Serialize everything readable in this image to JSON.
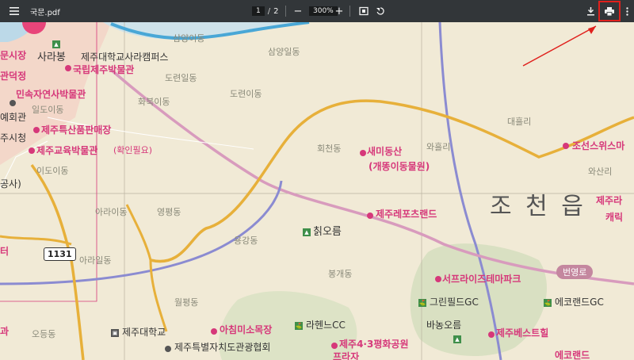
{
  "toolbar": {
    "menu_icon": "hamburger-menu-icon",
    "filename": "국문.pdf",
    "current_page": "1",
    "page_sep": "/",
    "total_pages": "2",
    "zoom_out": "−",
    "zoom_level": "300%",
    "zoom_in": "+",
    "fit_icon": "fit-to-page-icon",
    "rotate_icon": "rotate-icon",
    "download_icon": "download-icon",
    "print_icon": "print-icon",
    "more_icon": "more-vert-icon",
    "highlight_color": "#e0201c"
  },
  "map": {
    "labels": {
      "sarabong": "사라봉",
      "sara_campus": "제주대학교사라캠퍼스",
      "national_museum": "국립제주박물관",
      "samyang_upper": "삼양이동",
      "samyang_il": "삼양일동",
      "doryeon_il": "도련일동",
      "doryeon_i": "도련이동",
      "hwabuk_i": "화북이동",
      "ildo_i": "일도이동",
      "natural_history": "민속자연사박물관",
      "specialty": "제주특산품판매장",
      "education_museum": "제주교육박물관",
      "confirm_needed": "(확인필요)",
      "ido_i": "이도이동",
      "market_partial": "문시장",
      "gwandeok_partial": "관덕정",
      "gonghoe_partial": "예회관",
      "city_hall_partial": "주시청",
      "corp_partial": "공사)",
      "hoecheon": "회천동",
      "saemidongsan": "새미동산",
      "saemidongsan_sub": "(개똥이동물원)",
      "waheul": "와흘리",
      "daeheul": "대흘리",
      "joseon_switzerland": "조선스위스마",
      "wasan": "와산리",
      "jeju_ra_partial": "제주라",
      "kaeri_partial": "캐릭",
      "arai": "아라이동",
      "yeongpyeong": "영평동",
      "yonggang": "용강동",
      "jeju_report_land": "제주레포츠랜드",
      "jocheon": "조 천 읍",
      "chwioreum": "칡오름",
      "arail": "아라일동",
      "bonggae": "봉개동",
      "beonyeong_road": "번영로",
      "surprise_park": "서프라이즈테마파크",
      "green_field": "그린필드GC",
      "eco_land": "에코랜드GC",
      "wolpyeong": "월평동",
      "banong": "바농오름",
      "jeju_national_univ": "제주대학교",
      "acim_ranch": "아침미소목장",
      "lahenne": "라헨느CC",
      "peace_park": "제주4·3평화공원",
      "jeju_best_heal": "제주베스트힐",
      "tourism_assoc": "제주특별자치도관광협회",
      "odeung": "오등동",
      "road_1131": "1131",
      "teo_partial": "터",
      "gwa_partial": "과",
      "eco_land_bottom": "에코랜드",
      "peula_partial": "프라자"
    }
  }
}
